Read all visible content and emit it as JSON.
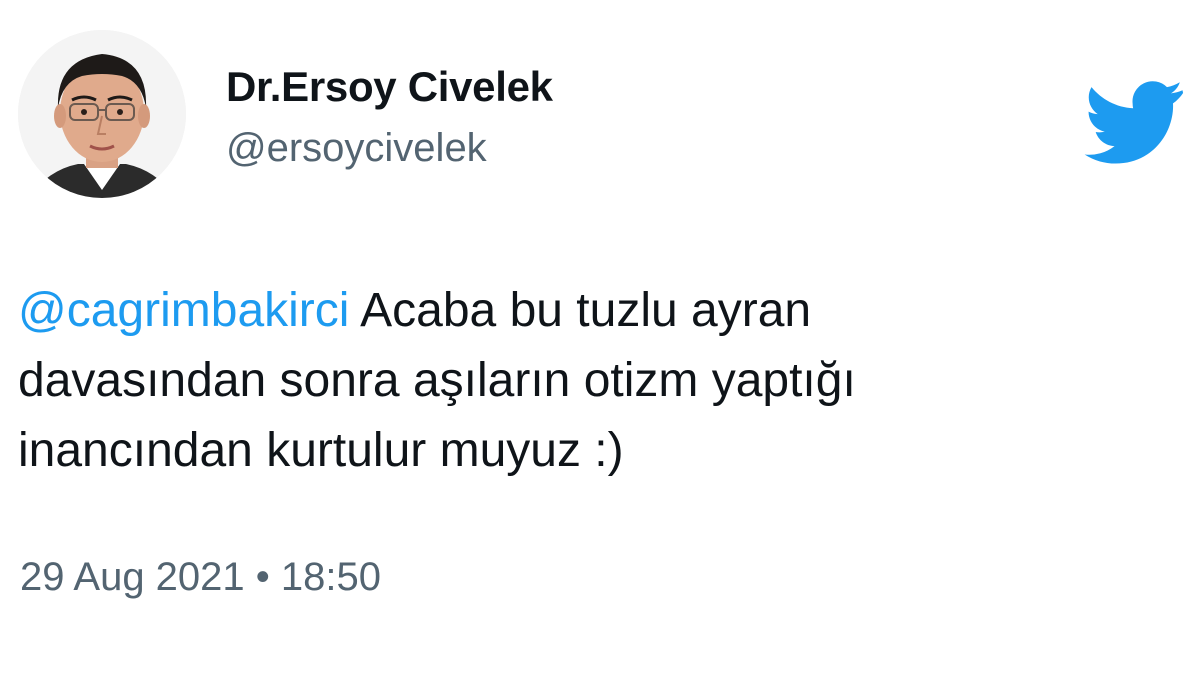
{
  "tweet": {
    "author": {
      "display_name": "Dr.Ersoy Civelek",
      "handle": "@ersoycivelek"
    },
    "mention": "@cagrimbakirci",
    "text": " Acaba bu tuzlu ayran davasından sonra aşıların otizm yaptığı inancından kurtulur muyuz :)",
    "timestamp": "29 Aug 2021 • 18:50",
    "icons": {
      "brand": "twitter-bird-icon"
    },
    "colors": {
      "link": "#1d9bf0",
      "brand": "#1d9bf0",
      "secondary_text": "#536471",
      "primary_text": "#0f1419"
    }
  }
}
